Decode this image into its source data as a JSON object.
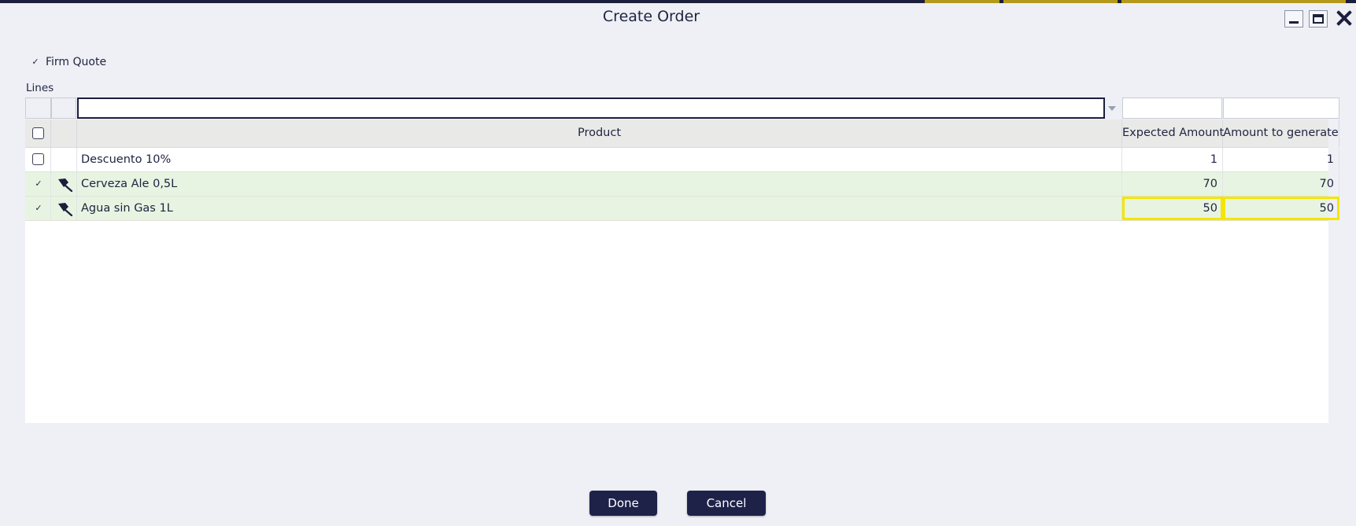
{
  "dialog": {
    "title": "Create Order"
  },
  "firm_quote": {
    "label": "Firm Quote",
    "checked": true
  },
  "lines": {
    "label": "Lines",
    "filter_value": "",
    "columns": {
      "product": "Product",
      "expected_amount": "Expected Amount",
      "amount_to_generate": "Amount to generate"
    },
    "rows": [
      {
        "product": "Descuento 10%",
        "expected": "1",
        "generate": "1",
        "selected": false,
        "pinned": false
      },
      {
        "product": "Cerveza Ale 0,5L",
        "expected": "70",
        "generate": "70",
        "selected": true,
        "pinned": true
      },
      {
        "product": "Agua sin Gas 1L",
        "expected": "50",
        "generate": "50",
        "selected": true,
        "pinned": true
      }
    ]
  },
  "buttons": {
    "done": "Done",
    "cancel": "Cancel"
  },
  "colors": {
    "accent": "#1e2249",
    "selected_row": "#e8f4e2",
    "highlight": "#f3e600"
  }
}
